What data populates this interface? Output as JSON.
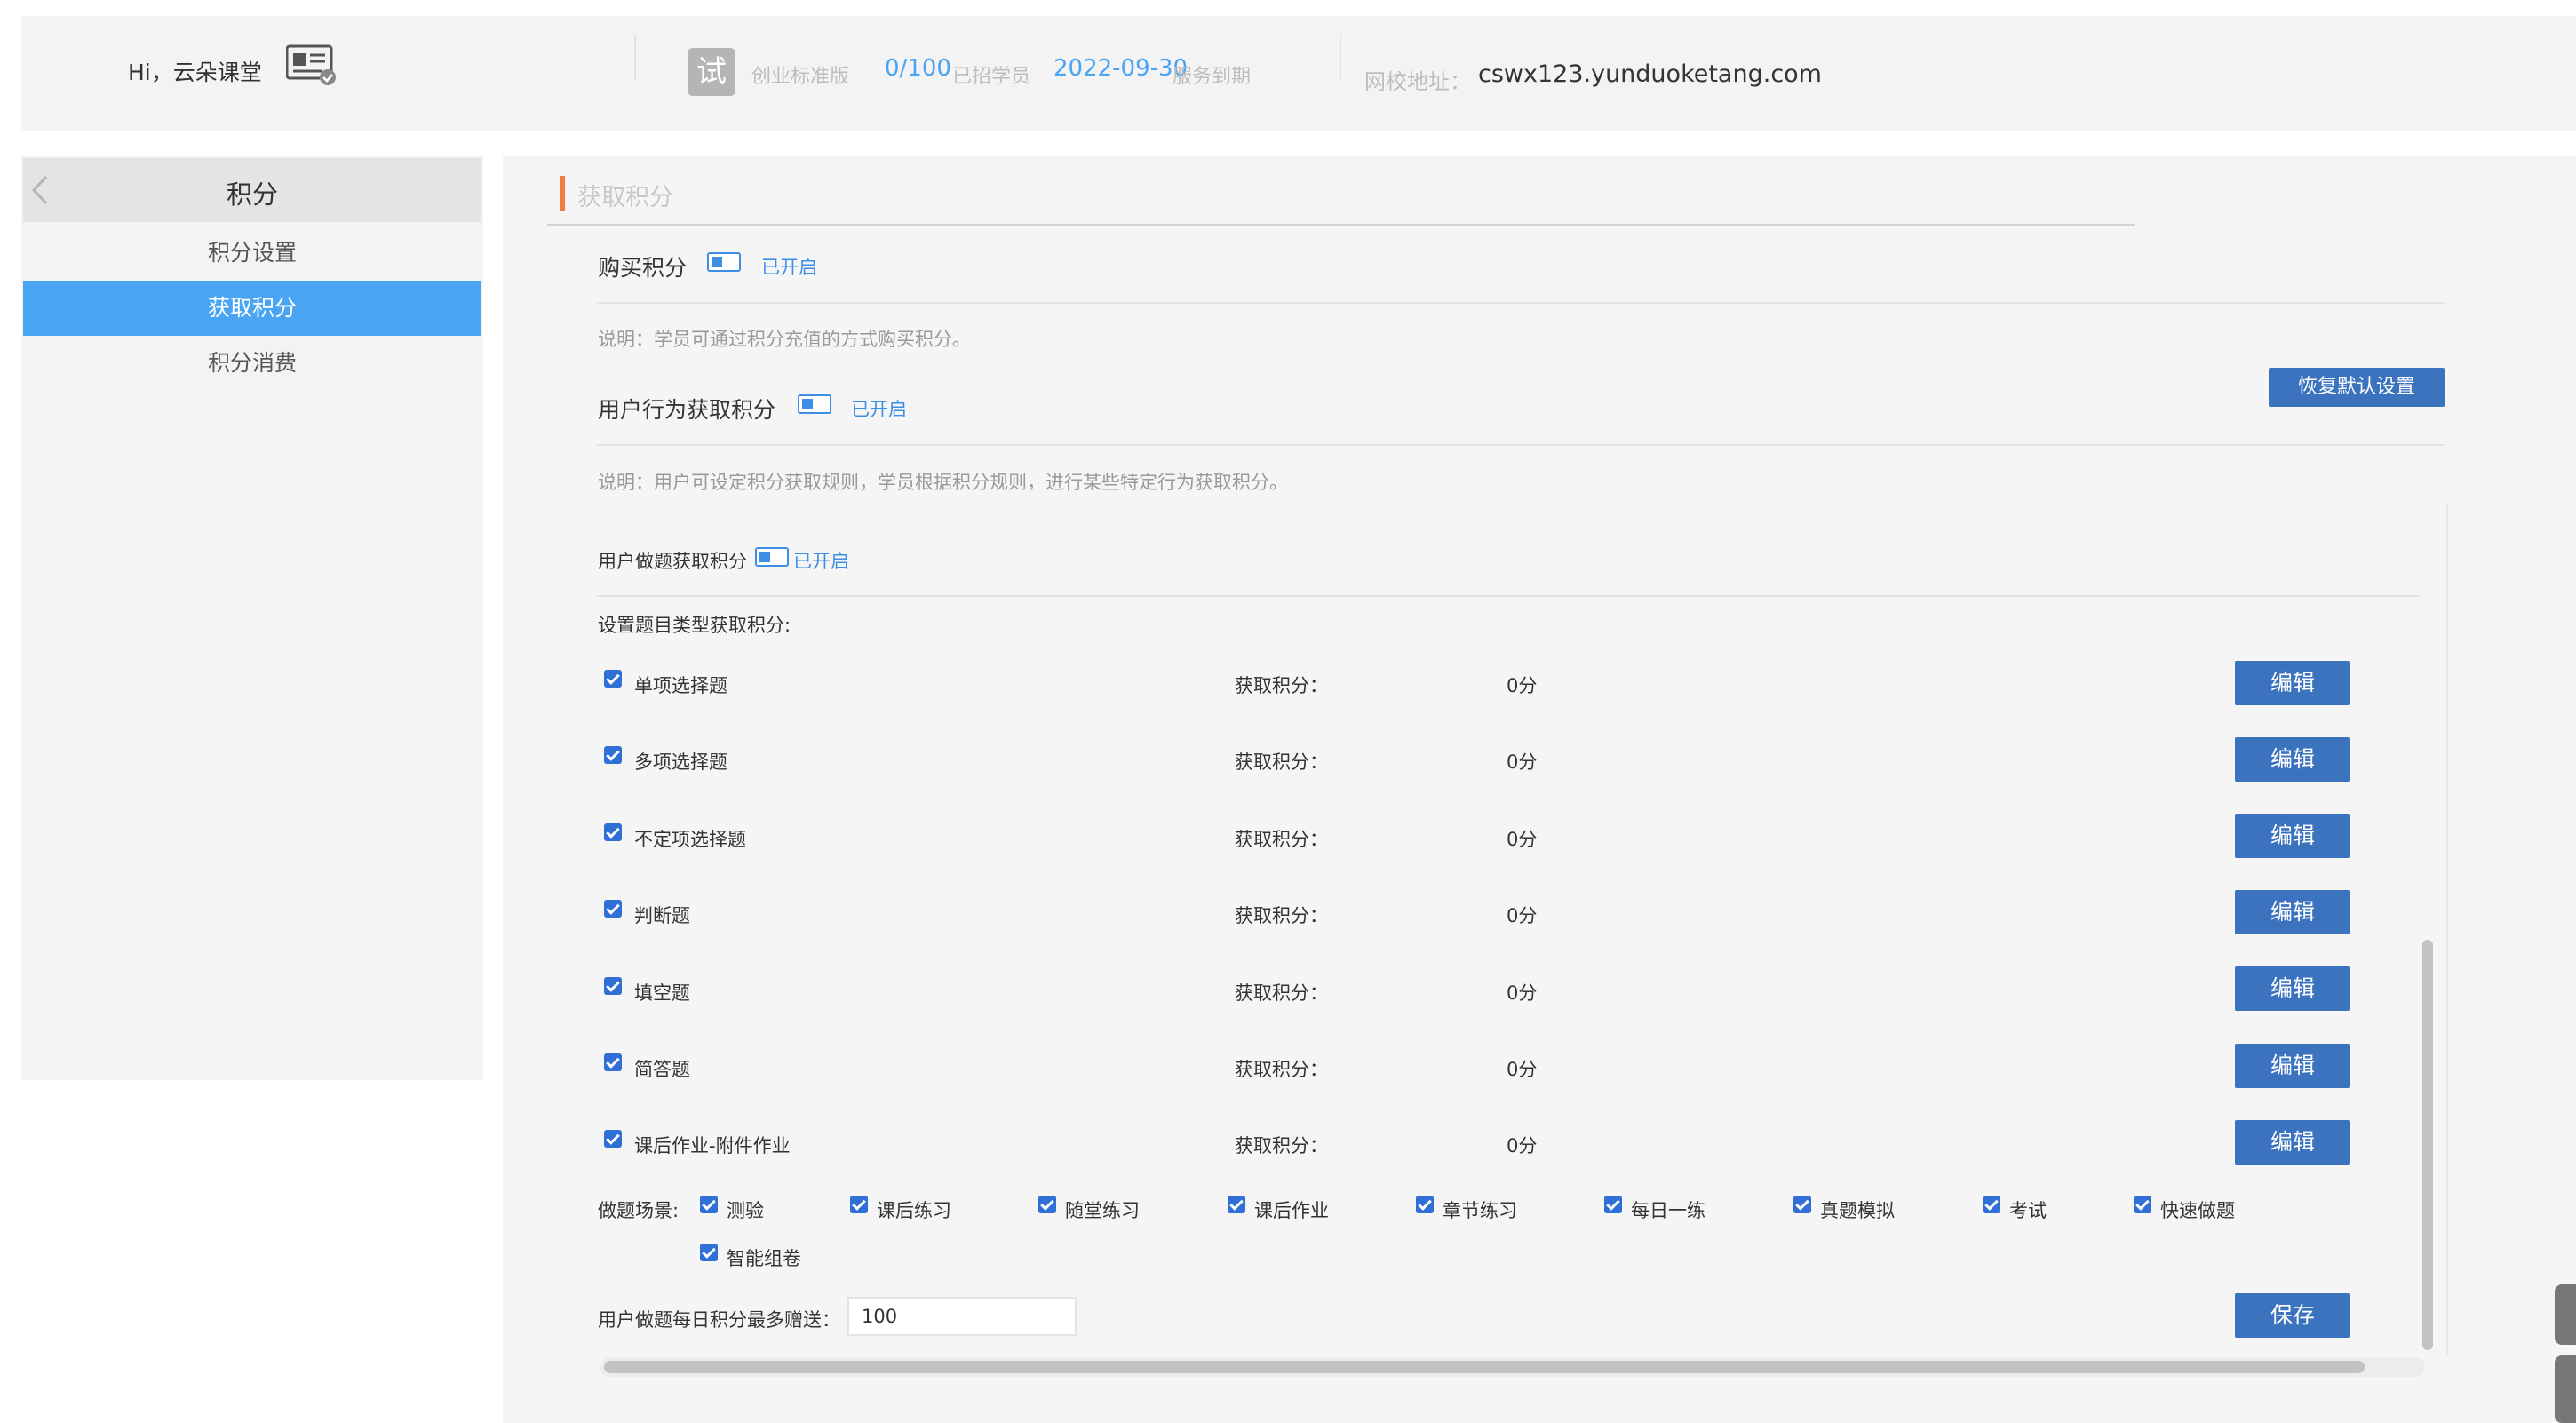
{
  "header": {
    "greeting": "Hi，云朵课堂",
    "trial_badge": "试",
    "edition": "创业标准版",
    "students_count": "0/100",
    "students_label": "已招学员",
    "expire_date": "2022-09-30",
    "expire_label": "服务到期",
    "url_label": "网校地址：",
    "url_value": "cswx123.yunduoketang.com",
    "accent_color": "#4aa4f4"
  },
  "sidebar": {
    "title": "积分",
    "items": [
      {
        "label": "积分设置",
        "active": false
      },
      {
        "label": "获取积分",
        "active": true
      },
      {
        "label": "积分消费",
        "active": false
      }
    ]
  },
  "main": {
    "title": "获取积分",
    "purchase": {
      "label": "购买积分",
      "status": "已开启",
      "desc": "说明：学员可通过积分充值的方式购买积分。"
    },
    "behavior": {
      "label": "用户行为获取积分",
      "status": "已开启",
      "desc": "说明：用户可设定积分获取规则，学员根据积分规则，进行某些特定行为获取积分。",
      "reset_button": "恢复默认设置"
    },
    "exercise": {
      "label": "用户做题获取积分",
      "status": "已开启",
      "type_label": "设置题目类型获取积分:",
      "rows": [
        {
          "name": "单项选择题",
          "label": "获取积分：",
          "value": "0分",
          "button": "编辑"
        },
        {
          "name": "多项选择题",
          "label": "获取积分：",
          "value": "0分",
          "button": "编辑"
        },
        {
          "name": "不定项选择题",
          "label": "获取积分：",
          "value": "0分",
          "button": "编辑"
        },
        {
          "name": "判断题",
          "label": "获取积分：",
          "value": "0分",
          "button": "编辑"
        },
        {
          "name": "填空题",
          "label": "获取积分：",
          "value": "0分",
          "button": "编辑"
        },
        {
          "name": "简答题",
          "label": "获取积分：",
          "value": "0分",
          "button": "编辑"
        },
        {
          "name": "课后作业-附件作业",
          "label": "获取积分：",
          "value": "0分",
          "button": "编辑"
        }
      ],
      "scene_label": "做题场景:",
      "scenes": [
        "测验",
        "课后练习",
        "随堂练习",
        "课后作业",
        "章节练习",
        "每日一练",
        "真题模拟",
        "考试",
        "快速做题",
        "智能组卷"
      ],
      "daily_label": "用户做题每日积分最多赠送：",
      "daily_value": "100",
      "save_button": "保存"
    }
  },
  "colors": {
    "primary_button": "#3b73bf",
    "active_sidebar": "#4aa4f4",
    "title_accent": "#f07b3f",
    "toggle": "#3f8ee6"
  }
}
